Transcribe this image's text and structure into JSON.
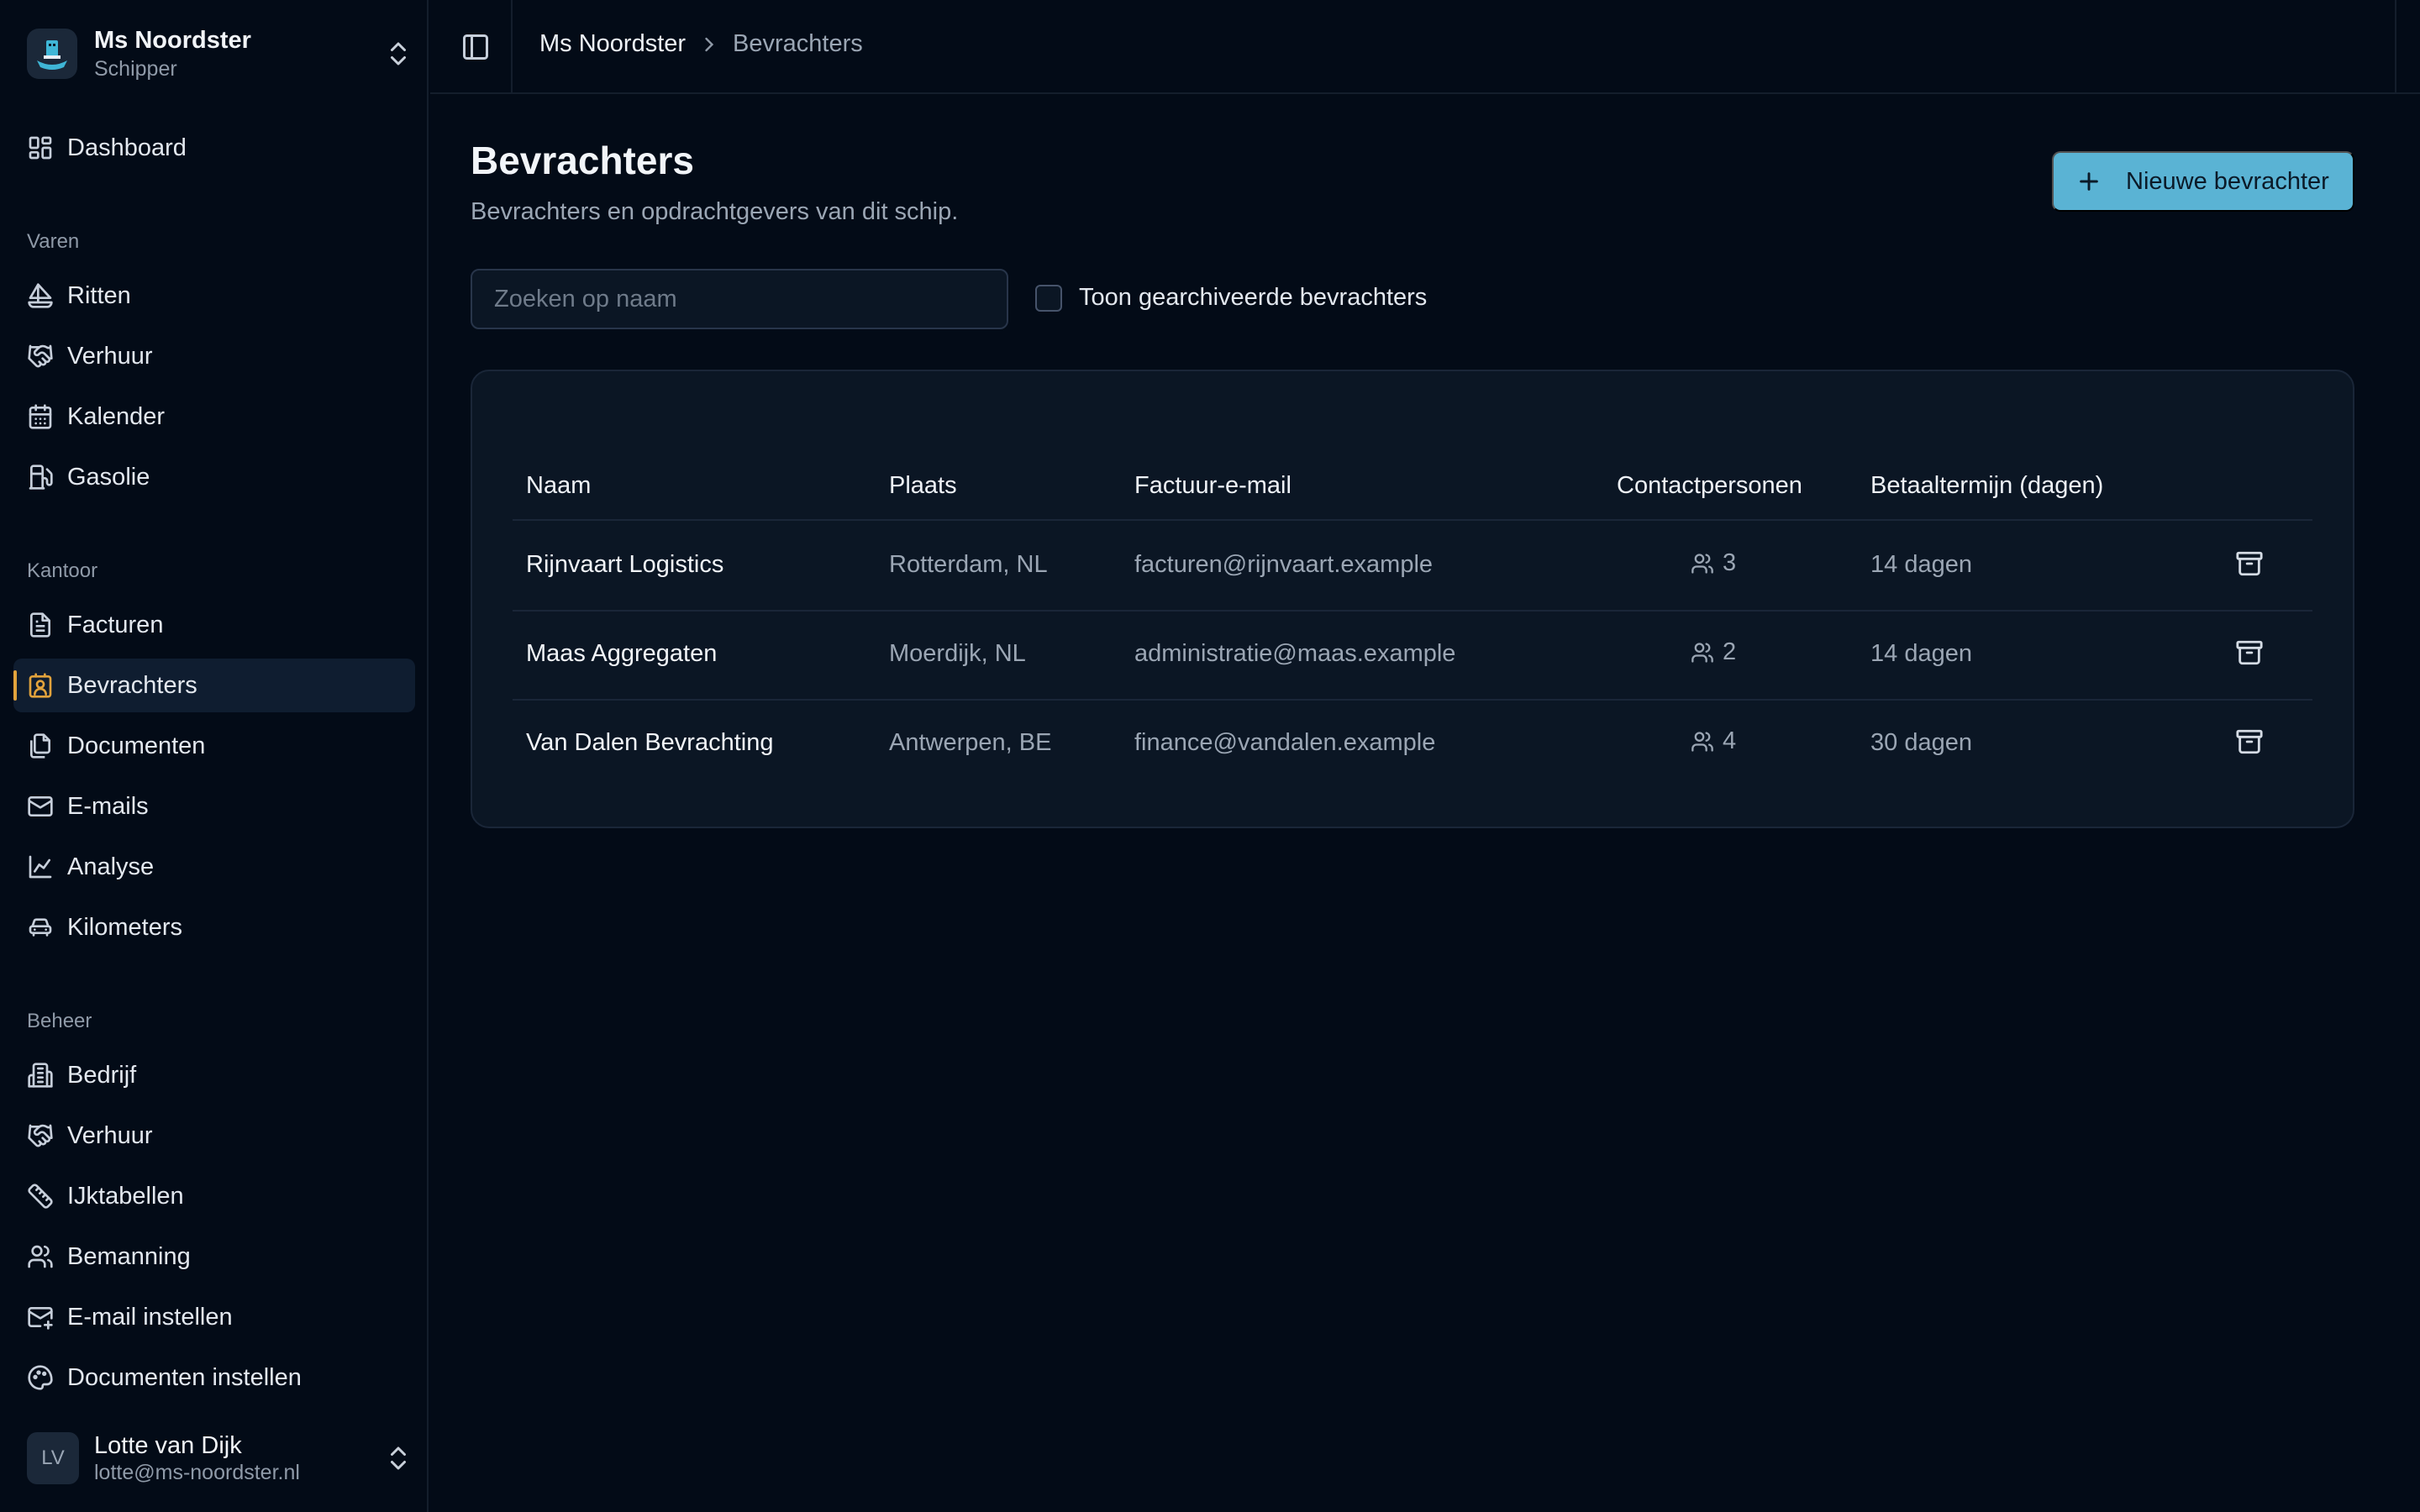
{
  "ship": {
    "name": "Ms Noordster",
    "role": "Schipper"
  },
  "nav": {
    "dashboard": "Dashboard",
    "sections": [
      {
        "label": "Varen",
        "items": [
          "Ritten",
          "Verhuur",
          "Kalender",
          "Gasolie"
        ]
      },
      {
        "label": "Kantoor",
        "items": [
          "Facturen",
          "Bevrachters",
          "Documenten",
          "E-mails",
          "Analyse",
          "Kilometers"
        ]
      },
      {
        "label": "Beheer",
        "items": [
          "Bedrijf",
          "Verhuur",
          "IJktabellen",
          "Bemanning",
          "E-mail instellen",
          "Documenten instellen"
        ]
      }
    ],
    "active": "Bevrachters"
  },
  "user": {
    "initials": "LV",
    "name": "Lotte van Dijk",
    "email": "lotte@ms-noordster.nl"
  },
  "breadcrumb": [
    "Ms Noordster",
    "Bevrachters"
  ],
  "page": {
    "title": "Bevrachters",
    "subtitle": "Bevrachters en opdrachtgevers van dit schip.",
    "new_button": "Nieuwe bevrachter",
    "search_placeholder": "Zoeken op naam",
    "search_value": "",
    "show_archived_label": "Toon gearchiveerde bevrachters",
    "show_archived_checked": false
  },
  "table": {
    "columns": [
      "Naam",
      "Plaats",
      "Factuur-e-mail",
      "Contactpersonen",
      "Betaaltermijn (dagen)"
    ],
    "rows": [
      {
        "name": "Rijnvaart Logistics",
        "place": "Rotterdam, NL",
        "email": "facturen@rijnvaart.example",
        "contacts": "3",
        "term": "14 dagen"
      },
      {
        "name": "Maas Aggregaten",
        "place": "Moerdijk, NL",
        "email": "administratie@maas.example",
        "contacts": "2",
        "term": "14 dagen"
      },
      {
        "name": "Van Dalen Bevrachting",
        "place": "Antwerpen, BE",
        "email": "finance@vandalen.example",
        "contacts": "4",
        "term": "30 dagen"
      }
    ]
  },
  "colors": {
    "background": "#030b17",
    "card": "#0b1624",
    "accent": "#5ab3d4",
    "active_indicator": "#e2a33c"
  },
  "icons": {
    "nav": [
      "dashboard-icon",
      "sailboat-icon",
      "handshake-icon",
      "calendar-icon",
      "fuel-icon",
      "file-text-icon",
      "contact-icon",
      "files-icon",
      "mail-icon",
      "chart-line-icon",
      "car-icon",
      "building-icon",
      "handshake-icon",
      "ruler-icon",
      "users-icon",
      "mail-plus-icon",
      "palette-icon"
    ],
    "row": [
      "users-icon",
      "archive-icon"
    ]
  }
}
